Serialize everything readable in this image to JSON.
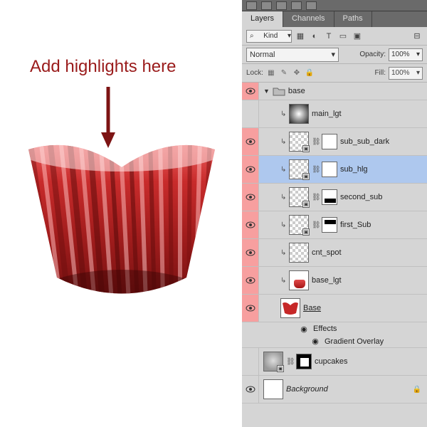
{
  "annot": {
    "text": "Add highlights here"
  },
  "panel": {
    "tabs": [
      "Layers",
      "Channels",
      "Paths"
    ],
    "active_tab": 0,
    "filter": {
      "label": "Kind",
      "glyph": "⌕"
    },
    "blend_mode": "Normal",
    "opacity": {
      "label": "Opacity:",
      "value": "100%"
    },
    "lock": {
      "label": "Lock:"
    },
    "fill": {
      "label": "Fill:",
      "value": "100%"
    },
    "group": {
      "name": "base"
    },
    "layers": [
      {
        "name": "main_lgt",
        "visible": false,
        "clipped": true,
        "mask": false,
        "thumb": "radial"
      },
      {
        "name": "sub_sub_dark",
        "visible": true,
        "clipped": true,
        "mask": true,
        "mask_style": "white",
        "thumb": "checker"
      },
      {
        "name": "sub_hlg",
        "visible": true,
        "clipped": true,
        "mask": true,
        "mask_style": "white",
        "thumb": "checker",
        "selected": true
      },
      {
        "name": "second_sub",
        "visible": true,
        "clipped": true,
        "mask": true,
        "mask_style": "bar",
        "thumb": "checker"
      },
      {
        "name": "first_Sub",
        "visible": true,
        "clipped": true,
        "mask": true,
        "mask_style": "bar",
        "thumb": "checker"
      },
      {
        "name": "cnt_spot",
        "visible": true,
        "clipped": true,
        "mask": false,
        "thumb": "checker"
      },
      {
        "name": "base_lgt",
        "visible": true,
        "clipped": true,
        "mask": false,
        "thumb": "red"
      }
    ],
    "base_layer": {
      "name": "Base",
      "effects_label": "Effects",
      "effect_item": "Gradient Overlay"
    },
    "cupcakes_layer": {
      "name": "cupcakes"
    },
    "background_layer": {
      "name": "Background"
    }
  }
}
